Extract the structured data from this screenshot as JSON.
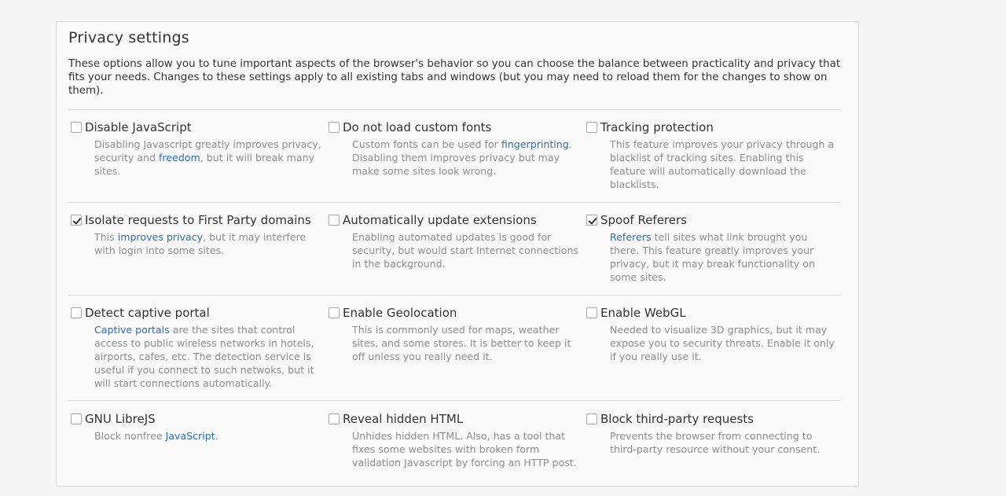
{
  "title": "Privacy settings",
  "intro": "These options allow you to tune important aspects of the browser's behavior so you can choose the balance between practicality and privacy that fits your needs. Changes to these settings apply to all existing tabs and windows (but you may need to reload them for the changes to show on them).",
  "options": [
    {
      "label": "Disable JavaScript",
      "checked": false,
      "desc_before": "Disabling Javascript greatly improves privacy, security and ",
      "link": "freedom",
      "desc_after": ", but it will break many sites."
    },
    {
      "label": "Do not load custom fonts",
      "checked": false,
      "desc_before": "Custom fonts can be used for ",
      "link": "fingerprinting",
      "desc_after": ". Disabling them improves privacy but may make some sites look wrong."
    },
    {
      "label": "Tracking protection",
      "checked": false,
      "desc_before": "This feature improves your privacy through a blacklist of tracking sites. Enabling this feature will automatically download the blacklists.",
      "link": "",
      "desc_after": ""
    },
    {
      "label": "Isolate requests to First Party domains",
      "checked": true,
      "desc_before": "This ",
      "link": "improves privacy",
      "desc_after": ", but it may interfere with login into some sites."
    },
    {
      "label": "Automatically update extensions",
      "checked": false,
      "desc_before": "Enabling automated updates is good for security, but would start Internet connections in the background.",
      "link": "",
      "desc_after": ""
    },
    {
      "label": "Spoof Referers",
      "checked": true,
      "desc_before": "",
      "link": "Referers",
      "desc_after": " tell sites what link brought you there. This feature greatly improves your privacy, but it may break functionality on some sites."
    },
    {
      "label": "Detect captive portal",
      "checked": false,
      "desc_before": "",
      "link": "Captive portals",
      "desc_after": " are the sites that control access to public wireless networks in hotels, airports, cafes, etc. The detection service is useful if you connect to such netwoks, but it will start connections automatically."
    },
    {
      "label": "Enable Geolocation",
      "checked": false,
      "desc_before": "This is commonly used for maps, weather sites, and some stores. It is better to keep it off unless you really need it.",
      "link": "",
      "desc_after": ""
    },
    {
      "label": "Enable WebGL",
      "checked": false,
      "desc_before": "Needed to visualize 3D graphics, but it may expose you to security threats. Enable it only if you really use it.",
      "link": "",
      "desc_after": ""
    },
    {
      "label": "GNU LibreJS",
      "checked": false,
      "desc_before": "Block nonfree ",
      "link": "JavaScript",
      "desc_after": "."
    },
    {
      "label": "Reveal hidden HTML",
      "checked": false,
      "desc_before": "Unhides hidden HTML. Also, has a tool that fixes some websites with broken form validation Javascript by forcing an HTTP post.",
      "link": "",
      "desc_after": ""
    },
    {
      "label": "Block third-party requests",
      "checked": false,
      "desc_before": "Prevents the browser from connecting to third-party resource without your consent.",
      "link": "",
      "desc_after": ""
    }
  ]
}
